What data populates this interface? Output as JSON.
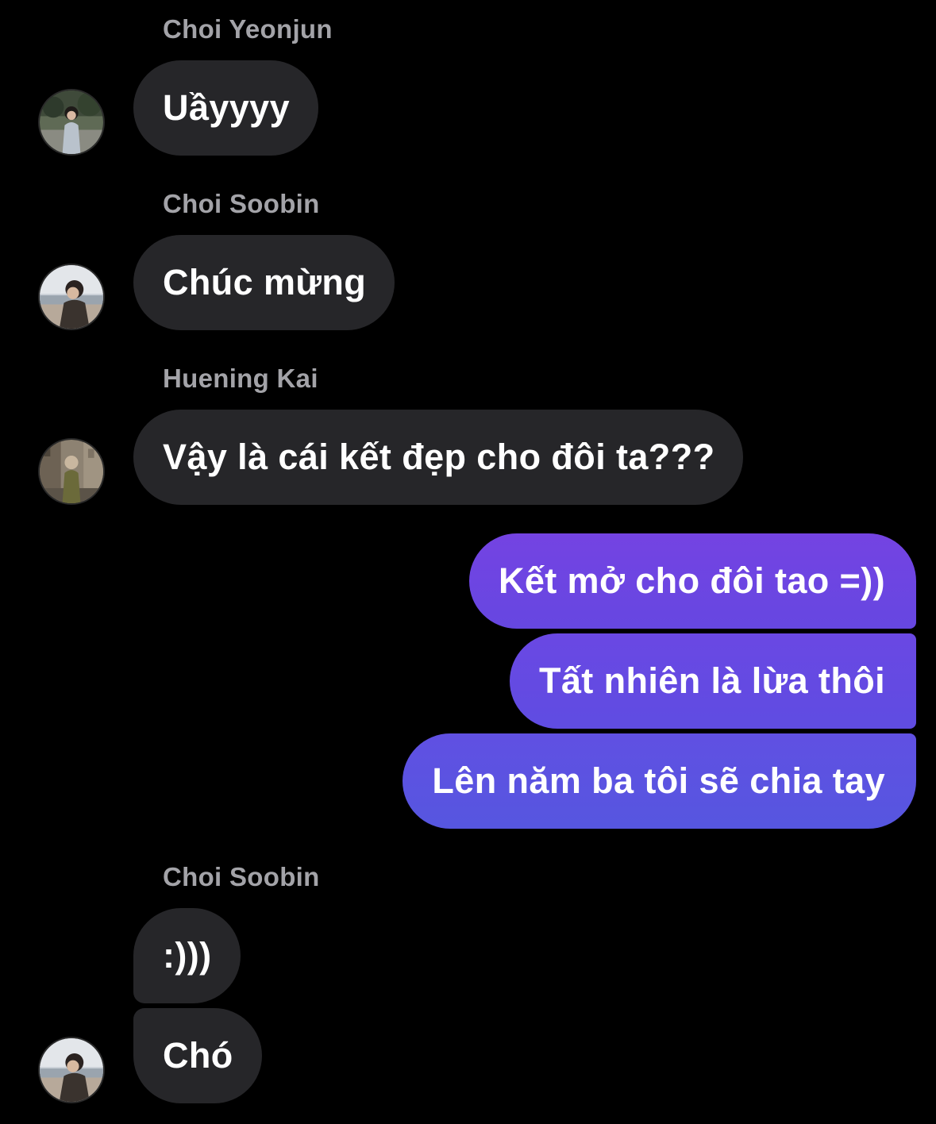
{
  "messages": [
    {
      "sender": "Choi Yeonjun",
      "text": "Uầyyyy"
    },
    {
      "sender": "Choi Soobin",
      "text": "Chúc mừng"
    },
    {
      "sender": "Huening Kai",
      "text": "Vậy là cái kết đẹp cho đôi ta???"
    },
    {
      "outgoing": [
        "Kết mở cho đôi tao =))",
        "Tất nhiên là lừa thôi",
        "Lên năm ba tôi sẽ chia tay"
      ]
    },
    {
      "sender": "Choi Soobin",
      "texts": [
        ":)))",
        "Chó"
      ]
    }
  ],
  "colors": {
    "background": "#000000",
    "incoming_bubble": "#262629",
    "outgoing_bubble_top": "#7443e2",
    "outgoing_bubble_bottom": "#5656e0",
    "sender_name": "#a3a3a8",
    "message_text": "#ffffff"
  },
  "avatars": [
    "avatar-yeonjun-photo",
    "avatar-soobin-photo",
    "avatar-kai-photo",
    "avatar-soobin-photo"
  ]
}
